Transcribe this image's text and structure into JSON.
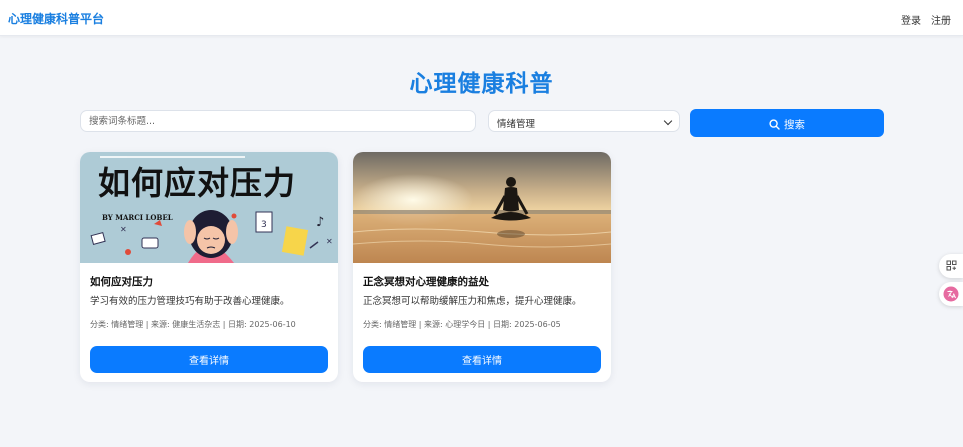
{
  "header": {
    "brand": "心理健康科普平台",
    "login": "登录",
    "register": "注册"
  },
  "main": {
    "title": "心理健康科普",
    "search": {
      "placeholder": "搜索词条标题...",
      "category_selected": "情绪管理",
      "button_label": "搜索"
    },
    "articles": [
      {
        "image_text": "如何应对压力",
        "image_byline": "BY MARCI LOBEL",
        "title": "如何应对压力",
        "description": "学习有效的压力管理技巧有助于改善心理健康。",
        "meta": "分类: 情绪管理 | 来源: 健康生活杂志 | 日期: 2025-06-10",
        "button": "查看详情"
      },
      {
        "title": "正念冥想对心理健康的益处",
        "description": "正念冥想可以帮助缓解压力和焦虑，提升心理健康。",
        "meta": "分类: 情绪管理 | 来源: 心理学今日 | 日期: 2025-06-05",
        "button": "查看详情"
      }
    ]
  },
  "side_widgets": [
    "apps-grid-icon",
    "translate-icon"
  ],
  "colors": {
    "accent": "#0a7bff",
    "brand": "#1a7fe0",
    "background": "#f3f5f9"
  }
}
